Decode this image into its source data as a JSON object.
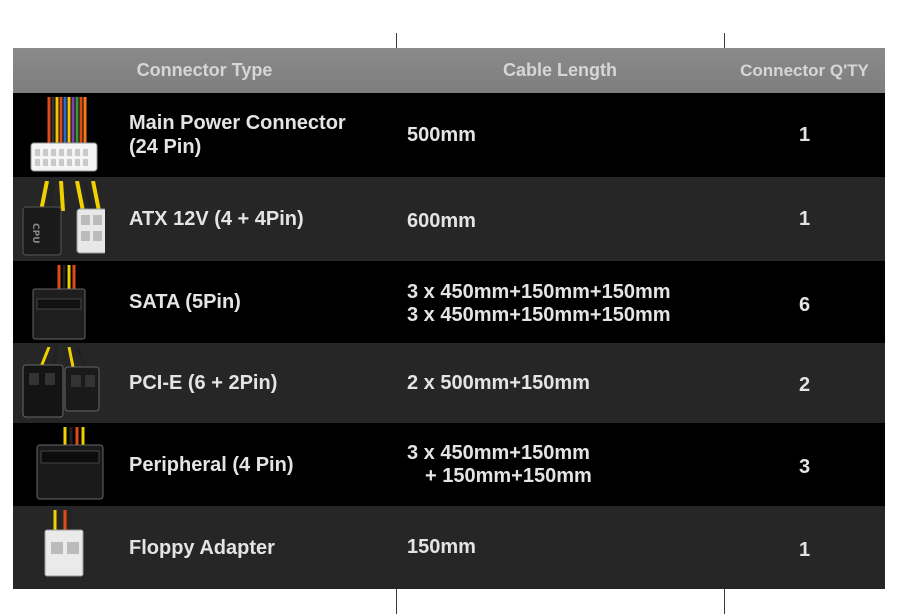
{
  "headers": {
    "type": "Connector Type",
    "length": "Cable Length",
    "qty": "Connector Q'TY"
  },
  "rows": [
    {
      "name_line1": "Main Power Connector",
      "name_line2": "(24 Pin)",
      "length_line1": "500mm",
      "length_line2": "",
      "qty": "1",
      "icon": "atx-24pin-connector-icon"
    },
    {
      "name_line1": "ATX 12V (4 + 4Pin)",
      "name_line2": "",
      "length_line1": "600mm",
      "length_line2": "",
      "qty": "1",
      "icon": "cpu-4plus4-connector-icon"
    },
    {
      "name_line1": "SATA (5Pin)",
      "name_line2": "",
      "length_line1": "3 x 450mm+150mm+150mm",
      "length_line2": "3 x 450mm+150mm+150mm",
      "qty": "6",
      "icon": "sata-connector-icon"
    },
    {
      "name_line1": "PCI-E (6 + 2Pin)",
      "name_line2": "",
      "length_line1": "2 x 500mm+150mm",
      "length_line2": "",
      "qty": "2",
      "icon": "pcie-connector-icon"
    },
    {
      "name_line1": "Peripheral (4 Pin)",
      "name_line2": "",
      "length_line1": "3 x 450mm+150mm",
      "length_line2": "+ 150mm+150mm",
      "qty": "3",
      "icon": "molex-connector-icon"
    },
    {
      "name_line1": "Floppy Adapter",
      "name_line2": "",
      "length_line1": "150mm",
      "length_line2": "",
      "qty": "1",
      "icon": "floppy-connector-icon"
    }
  ]
}
